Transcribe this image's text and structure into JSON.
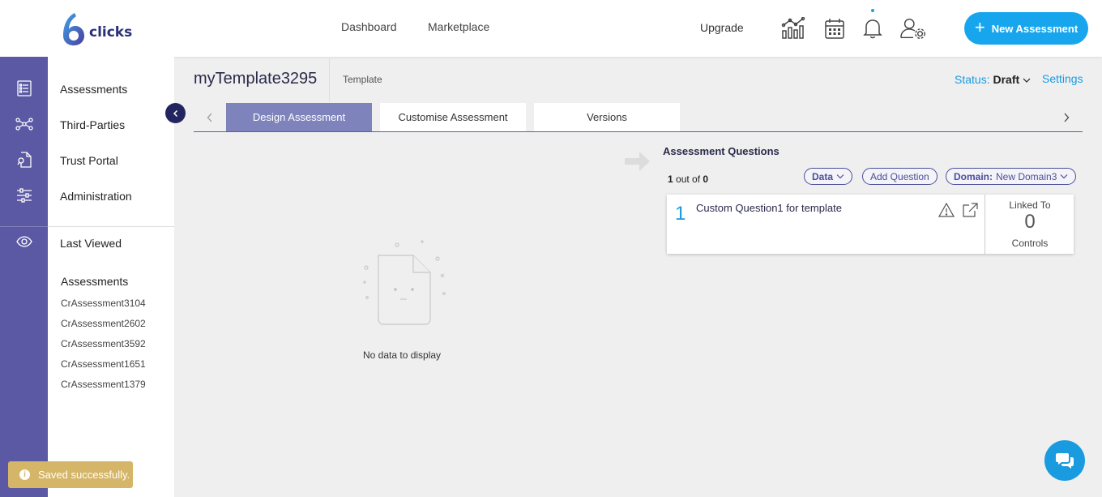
{
  "header": {
    "logo_text": "clicks",
    "nav": [
      "Dashboard",
      "Marketplace"
    ],
    "upgrade_label": "Upgrade",
    "new_button_label": "New Assessment",
    "icons": [
      "analytics-icon",
      "calendar-icon",
      "bell-icon",
      "user-settings-icon"
    ]
  },
  "sidebar": {
    "items": [
      {
        "label": "Assessments",
        "icon": "checklist-icon"
      },
      {
        "label": "Third-Parties",
        "icon": "network-icon"
      },
      {
        "label": "Trust Portal",
        "icon": "document-search-icon"
      },
      {
        "label": "Administration",
        "icon": "sliders-icon"
      }
    ],
    "last_viewed": {
      "label": "Last Viewed",
      "icon": "eye-icon"
    },
    "recent_heading": "Assessments",
    "recent": [
      "CrAssessment3104",
      "CrAssessment2602",
      "CrAssessment3592",
      "CrAssessment1651",
      "CrAssessment1379"
    ]
  },
  "page": {
    "title": "myTemplate3295",
    "type_label": "Template",
    "status_label": "Status:",
    "status_value": "Draft",
    "settings_label": "Settings"
  },
  "tabs": [
    {
      "label": "Design Assessment",
      "active": true
    },
    {
      "label": "Customise Assessment",
      "active": false
    },
    {
      "label": "Versions",
      "active": false
    }
  ],
  "empty_state": {
    "text": "No data to display"
  },
  "questions": {
    "title": "Assessment Questions",
    "count_current": "1",
    "count_sep": " out of ",
    "count_total": "0",
    "data_label": "Data",
    "add_label": "Add Question",
    "domain_label": "Domain:",
    "domain_value": "New Domain3",
    "items": [
      {
        "number": "1",
        "text": "Custom Question1 for template",
        "linked_label": "Linked To",
        "linked_count": "0",
        "linked_sub": "Controls"
      }
    ]
  },
  "toast": {
    "text": "Saved successfully."
  },
  "colors": {
    "accent": "#1a9be0",
    "rail": "#5b59a3",
    "tab_active": "#7f83bc",
    "toast": "#d5b567"
  }
}
